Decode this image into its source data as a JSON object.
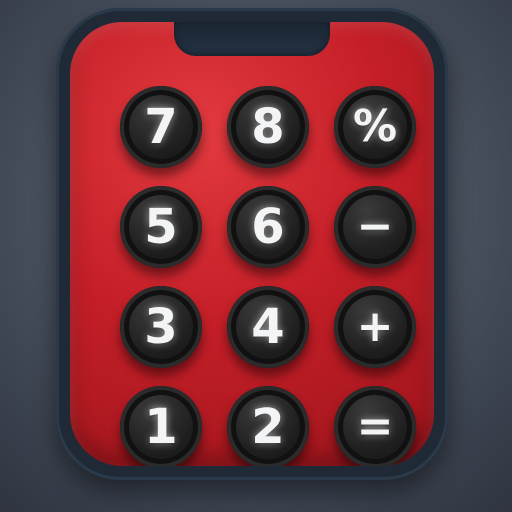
{
  "keypad": {
    "keys": [
      {
        "label": "7",
        "icon": "digit"
      },
      {
        "label": "8",
        "icon": "digit"
      },
      {
        "label": "%",
        "icon": "percent-icon"
      },
      {
        "label": "5",
        "icon": "digit"
      },
      {
        "label": "6",
        "icon": "digit"
      },
      {
        "label": "−",
        "icon": "minus-icon"
      },
      {
        "label": "3",
        "icon": "digit"
      },
      {
        "label": "4",
        "icon": "digit"
      },
      {
        "label": "+",
        "icon": "plus-icon"
      },
      {
        "label": "1",
        "icon": "digit"
      },
      {
        "label": "2",
        "icon": "digit"
      },
      {
        "label": "=",
        "icon": "equals-icon"
      }
    ]
  },
  "colors": {
    "body": "#c51f28",
    "frame": "#1f2a36",
    "key": "#1f1f1f",
    "key_text": "#f3f4f6"
  }
}
